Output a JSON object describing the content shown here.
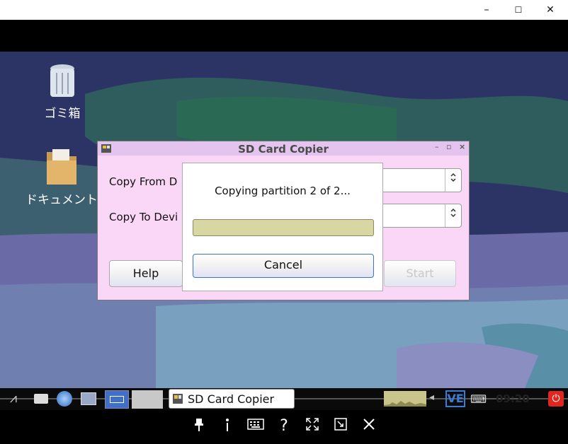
{
  "window_controls": {
    "minimize": "–",
    "maximize": "☐",
    "close": "✕"
  },
  "desktop": {
    "icons": [
      {
        "label": "ゴミ箱",
        "icon": "trash-icon"
      },
      {
        "label": "ドキュメント",
        "icon": "documents-folder-icon"
      }
    ]
  },
  "dialog": {
    "title": "SD Card Copier",
    "controls": {
      "minimize": "–",
      "maximize": "▫",
      "close": "×"
    },
    "copy_from_label": "Copy From D",
    "copy_to_label": "Copy To Devi",
    "combo_arrow": "⌃⌄",
    "help_label": "Help",
    "start_label": "Start"
  },
  "progress": {
    "message": "Copying partition 2 of 2...",
    "fraction": 0.0,
    "cancel_label": "Cancel"
  },
  "taskbar": {
    "task_label": "SD Card Copier",
    "clock": "09:20",
    "keyboard_layout": "VE"
  },
  "colors": {
    "dialog_bg": "#fbd7f7",
    "progress_fill": "#d8d6a2",
    "accent": "#3060c0"
  }
}
